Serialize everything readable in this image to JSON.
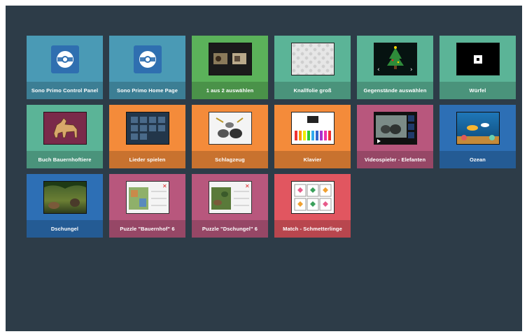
{
  "tiles": [
    {
      "label": "Sono Primo Control Panel",
      "color": "#4a9ab5",
      "icon": "sono-primo-logo-icon"
    },
    {
      "label": "Sono Primo Home Page",
      "color": "#4a9ab5",
      "icon": "sono-primo-logo-icon"
    },
    {
      "label": "1 aus 2 auswählen",
      "color": "#5bb25a",
      "icon": "choose-one-of-two-icon"
    },
    {
      "label": "Knallfolie groß",
      "color": "#5bb497",
      "icon": "bubble-wrap-icon"
    },
    {
      "label": "Gegenstände auswählen",
      "color": "#5bb497",
      "icon": "christmas-tree-icon"
    },
    {
      "label": "Würfel",
      "color": "#5bb497",
      "icon": "dice-icon"
    },
    {
      "label": "Buch Bauernhoftiere",
      "color": "#5bb497",
      "icon": "dog-icon"
    },
    {
      "label": "Lieder spielen",
      "color": "#f48b3a",
      "icon": "song-grid-icon"
    },
    {
      "label": "Schlagzeug",
      "color": "#f48b3a",
      "icon": "drum-kit-icon"
    },
    {
      "label": "Klavier",
      "color": "#f48b3a",
      "icon": "piano-icon"
    },
    {
      "label": "Videospieler - Elefanten",
      "color": "#b8577d",
      "icon": "elephant-video-icon"
    },
    {
      "label": "Ozean",
      "color": "#2d6fb5",
      "icon": "ocean-icon"
    },
    {
      "label": "Dschungel",
      "color": "#2d6fb5",
      "icon": "jungle-icon"
    },
    {
      "label": "Puzzle \"Bauernhof\" 6",
      "color": "#b8577d",
      "icon": "puzzle-farm-icon"
    },
    {
      "label": "Puzzle \"Dschungel\" 6",
      "color": "#b8577d",
      "icon": "puzzle-jungle-icon"
    },
    {
      "label": "Match - Schmetterlinge",
      "color": "#e15660",
      "icon": "butterfly-match-icon"
    }
  ]
}
